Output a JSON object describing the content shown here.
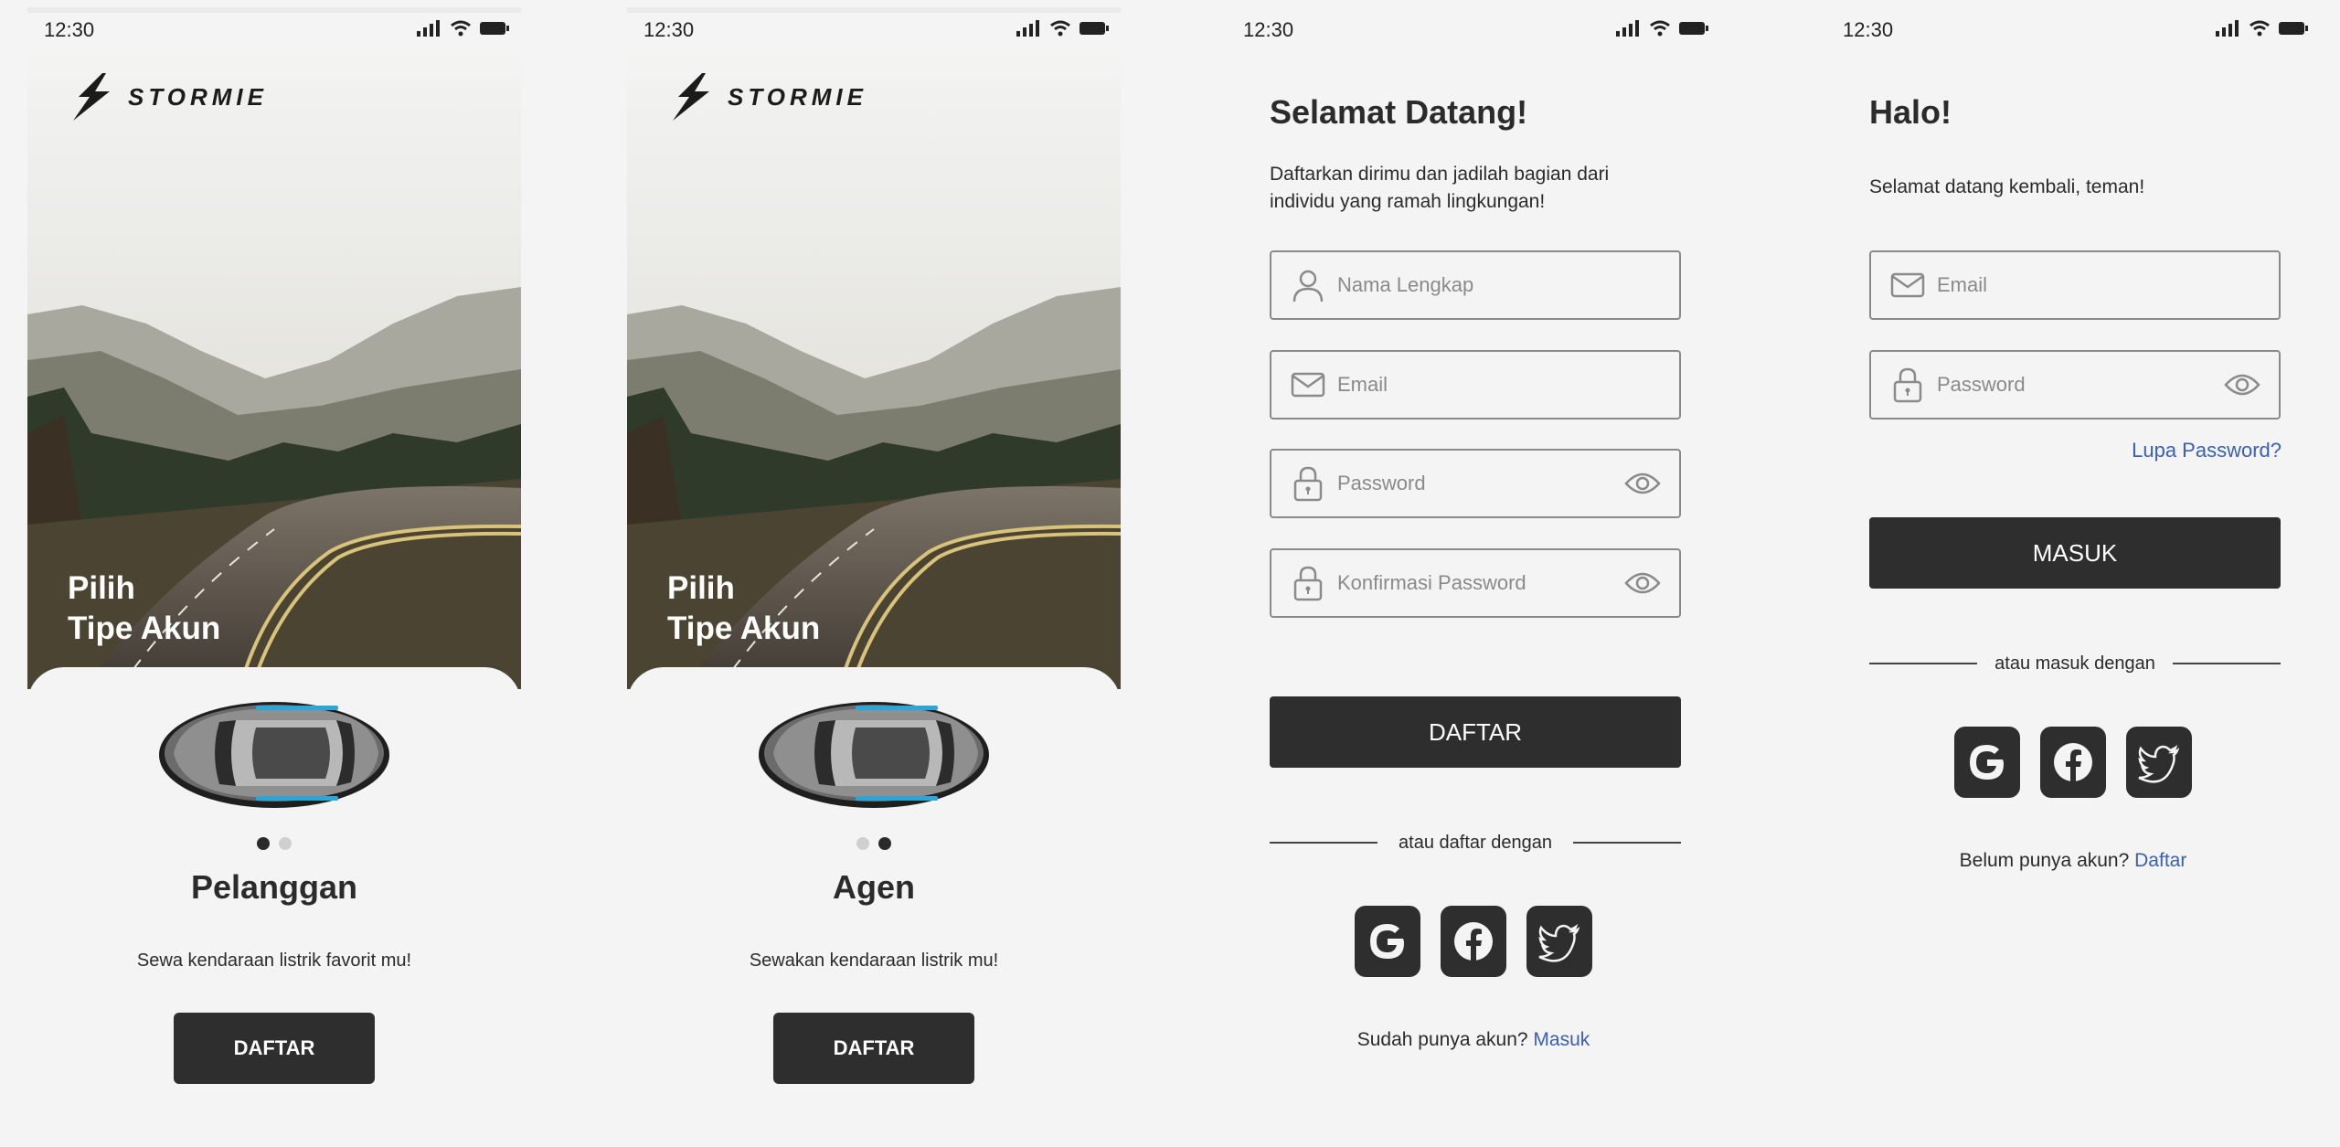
{
  "status_bar": {
    "time": "12:30"
  },
  "brand": {
    "name": "STORMIE"
  },
  "screens": [
    {
      "hero_title_line1": "Pilih",
      "hero_title_line2": "Tipe Akun",
      "type_title": "Pelanggan",
      "type_desc": "Sewa kendaraan listrik favorit mu!",
      "button": "DAFTAR",
      "active_dot": 0
    },
    {
      "hero_title_line1": "Pilih",
      "hero_title_line2": "Tipe Akun",
      "type_title": "Agen",
      "type_desc": "Sewakan kendaraan listrik mu!",
      "button": "DAFTAR",
      "active_dot": 1
    }
  ],
  "register": {
    "title": "Selamat Datang!",
    "subtitle": "Daftarkan dirimu dan jadilah bagian dari individu yang ramah lingkungan!",
    "name_placeholder": "Nama Lengkap",
    "email_placeholder": "Email",
    "password_placeholder": "Password",
    "confirm_placeholder": "Konfirmasi Password",
    "button": "DAFTAR",
    "divider": "atau daftar dengan",
    "footer_text": "Sudah punya akun?",
    "footer_link": "Masuk"
  },
  "login": {
    "title": "Halo!",
    "subtitle": "Selamat datang kembali, teman!",
    "email_placeholder": "Email",
    "password_placeholder": "Password",
    "forgot": "Lupa Password?",
    "button": "MASUK",
    "divider": "atau masuk dengan",
    "footer_text": "Belum punya akun?",
    "footer_link": "Daftar"
  },
  "social_icons": [
    "google-icon",
    "facebook-icon",
    "twitter-icon"
  ],
  "colors": {
    "dark": "#2e2e2e",
    "link": "#3a5fb5",
    "background": "#f4f4f4"
  }
}
